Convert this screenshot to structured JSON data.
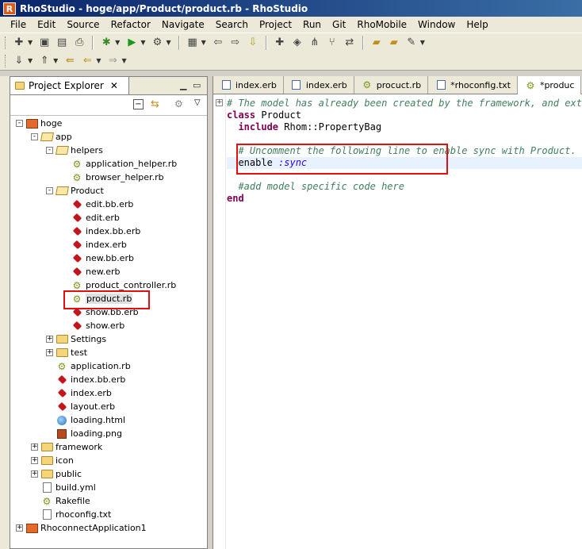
{
  "window": {
    "title": "RhoStudio - hoge/app/Product/product.rb - RhoStudio",
    "app_icon": "rhostudio-icon"
  },
  "menu": [
    "File",
    "Edit",
    "Source",
    "Refactor",
    "Navigate",
    "Search",
    "Project",
    "Run",
    "Git",
    "RhoMobile",
    "Window",
    "Help"
  ],
  "explorer": {
    "title": "Project Explorer",
    "tree": [
      {
        "label": "hoge",
        "icon": "project",
        "level": 0,
        "expander": "-"
      },
      {
        "label": "app",
        "icon": "folder-open",
        "level": 1,
        "expander": "-"
      },
      {
        "label": "helpers",
        "icon": "folder-open",
        "level": 2,
        "expander": "-"
      },
      {
        "label": "application_helper.rb",
        "icon": "rbfile",
        "level": 3
      },
      {
        "label": "browser_helper.rb",
        "icon": "rbfile",
        "level": 3
      },
      {
        "label": "Product",
        "icon": "folder-open",
        "level": 2,
        "expander": "-"
      },
      {
        "label": "edit.bb.erb",
        "icon": "ruby",
        "level": 3
      },
      {
        "label": "edit.erb",
        "icon": "ruby",
        "level": 3
      },
      {
        "label": "index.bb.erb",
        "icon": "ruby",
        "level": 3
      },
      {
        "label": "index.erb",
        "icon": "ruby",
        "level": 3
      },
      {
        "label": "new.bb.erb",
        "icon": "ruby",
        "level": 3
      },
      {
        "label": "new.erb",
        "icon": "ruby",
        "level": 3
      },
      {
        "label": "product_controller.rb",
        "icon": "rbfile",
        "level": 3
      },
      {
        "label": "product.rb",
        "icon": "rbfile",
        "level": 3,
        "selected": true
      },
      {
        "label": "show.bb.erb",
        "icon": "ruby",
        "level": 3
      },
      {
        "label": "show.erb",
        "icon": "ruby",
        "level": 3
      },
      {
        "label": "Settings",
        "icon": "folder",
        "level": 2,
        "expander": "+"
      },
      {
        "label": "test",
        "icon": "folder",
        "level": 2,
        "expander": "+"
      },
      {
        "label": "application.rb",
        "icon": "rbfile",
        "level": 2
      },
      {
        "label": "index.bb.erb",
        "icon": "ruby",
        "level": 2
      },
      {
        "label": "index.erb",
        "icon": "ruby",
        "level": 2
      },
      {
        "label": "layout.erb",
        "icon": "ruby",
        "level": 2
      },
      {
        "label": "loading.html",
        "icon": "globe",
        "level": 2
      },
      {
        "label": "loading.png",
        "icon": "png",
        "level": 2
      },
      {
        "label": "framework",
        "icon": "folder",
        "level": 1,
        "expander": "+"
      },
      {
        "label": "icon",
        "icon": "folder",
        "level": 1,
        "expander": "+"
      },
      {
        "label": "public",
        "icon": "folder",
        "level": 1,
        "expander": "+"
      },
      {
        "label": "build.yml",
        "icon": "txtfile",
        "level": 1
      },
      {
        "label": "Rakefile",
        "icon": "rbfile",
        "level": 1
      },
      {
        "label": "rhoconfig.txt",
        "icon": "txtfile",
        "level": 1
      },
      {
        "label": "RhoconnectApplication1",
        "icon": "project",
        "level": 0,
        "expander": "+"
      }
    ]
  },
  "editor": {
    "tabs": [
      {
        "label": "index.erb",
        "icon": "erb-file-icon"
      },
      {
        "label": "index.erb",
        "icon": "erb-file-icon"
      },
      {
        "label": "procuct.rb",
        "icon": "ruby-file-icon"
      },
      {
        "label": "*rhoconfig.txt",
        "icon": "text-file-icon"
      },
      {
        "label": "*produc",
        "icon": "ruby-file-icon",
        "active": true
      }
    ],
    "lines": [
      {
        "text": "# The model has already been created by the framework, and ext",
        "type": "comment",
        "indent": ""
      },
      {
        "kw": "class",
        "text": " Product",
        "indent": ""
      },
      {
        "kw": "include",
        "text": " Rhom::PropertyBag",
        "indent": "  "
      },
      {
        "text": "",
        "indent": ""
      },
      {
        "text": "# Uncomment the following line to enable sync with Product.",
        "type": "comment",
        "indent": "  "
      },
      {
        "text": "enable ",
        "sym": ":sync",
        "indent": "  ",
        "highlight": true
      },
      {
        "text": "",
        "indent": ""
      },
      {
        "text": "#add model specific code here",
        "type": "comment",
        "indent": "  "
      },
      {
        "kw": "end",
        "text": "",
        "indent": ""
      }
    ]
  }
}
